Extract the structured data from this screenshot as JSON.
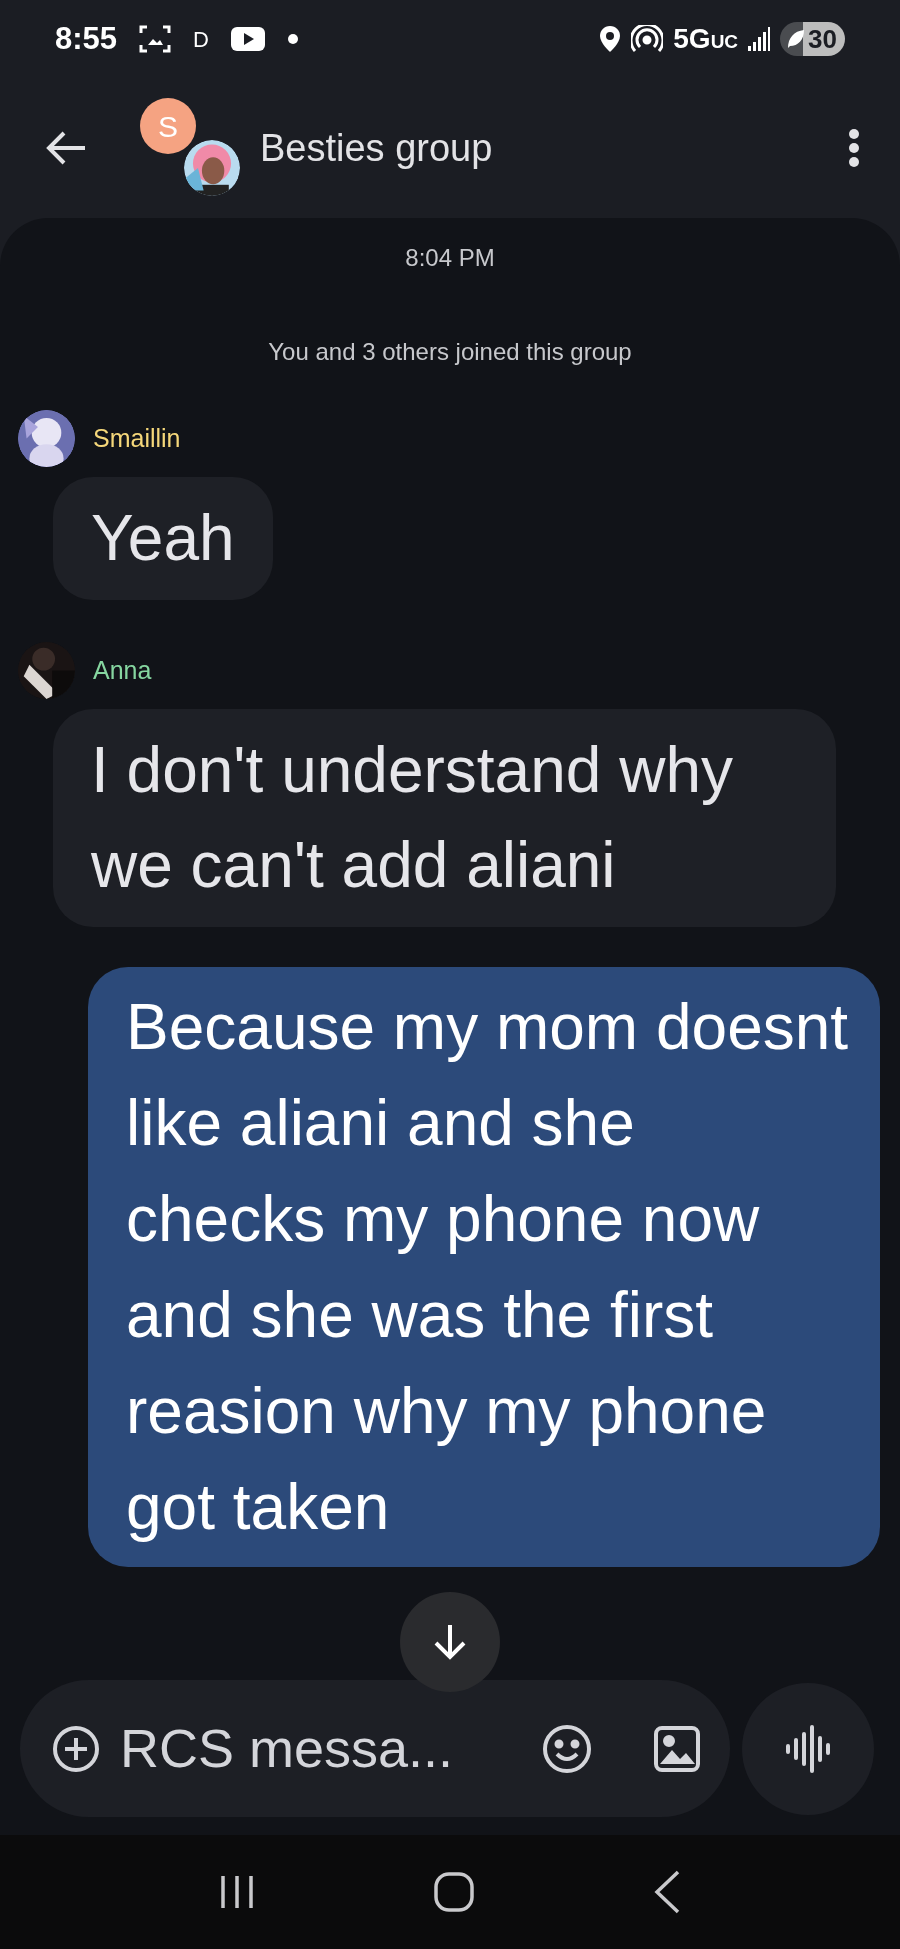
{
  "status_bar": {
    "time": "8:55",
    "notification_letter": "D",
    "network": "5G",
    "network_suffix": "UC",
    "battery": "30"
  },
  "header": {
    "avatar_letter": "S",
    "title": "Besties group"
  },
  "conversation": {
    "timestamp": "8:04 PM",
    "system_note": "You and 3 others joined this group",
    "messages": [
      {
        "kind": "incoming",
        "sender": "Smaillin",
        "color": "#f5d77a",
        "text": "Yeah"
      },
      {
        "kind": "incoming",
        "sender": "Anna",
        "color": "#86d6a0",
        "text": "I don't understand why we can't add aliani"
      },
      {
        "kind": "outgoing",
        "text": "Because my mom doesnt like aliani and she checks my phone now and she was the first reasion why my phone got taken"
      }
    ]
  },
  "composer": {
    "placeholder": "RCS messa..."
  }
}
